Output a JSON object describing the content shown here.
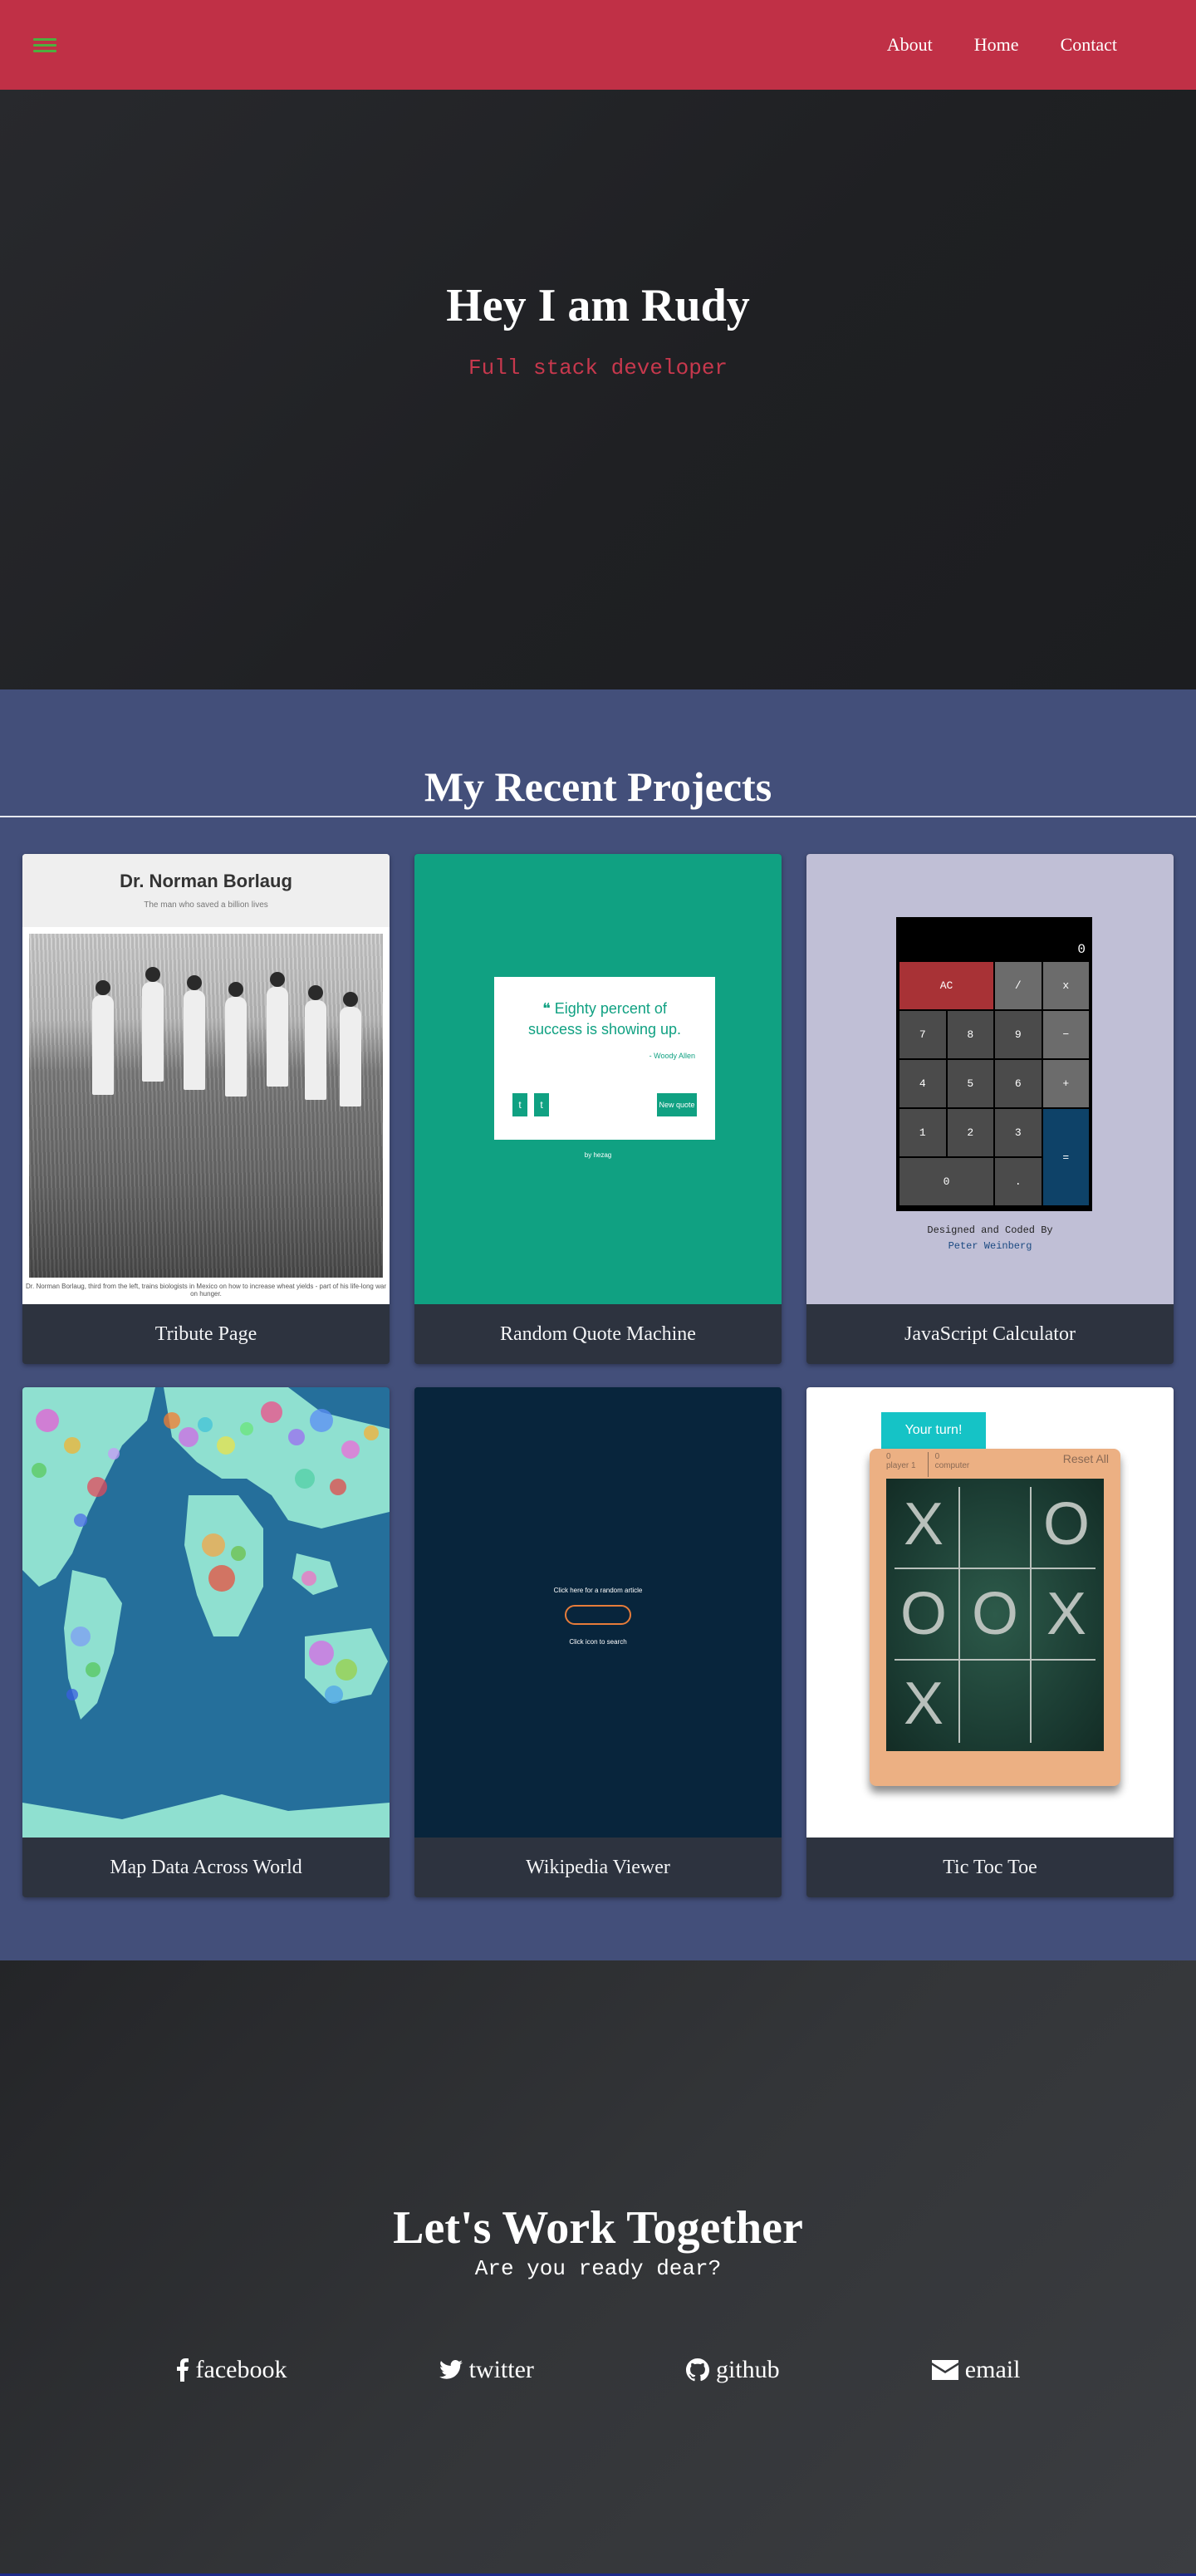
{
  "nav": {
    "links": [
      "About",
      "Home",
      "Contact"
    ],
    "colors": {
      "bar": "#c03046",
      "menu_icon": "#4fae3e"
    }
  },
  "hero": {
    "title": "Hey I am Rudy",
    "subtitle": "Full stack developer"
  },
  "projects": {
    "heading": "My Recent Projects",
    "items": [
      {
        "title": "Tribute Page",
        "thumb_icon": "tribute-screenshot"
      },
      {
        "title": "Random Quote Machine",
        "thumb_icon": "quote-screenshot"
      },
      {
        "title": "JavaScript Calculator",
        "thumb_icon": "calculator-screenshot"
      },
      {
        "title": "Map Data Across World",
        "thumb_icon": "map-screenshot"
      },
      {
        "title": "Wikipedia Viewer",
        "thumb_icon": "wiki-screenshot"
      },
      {
        "title": "Tic Toc Toe",
        "thumb_icon": "tictactoe-screenshot"
      }
    ],
    "thumbs": {
      "tribute": {
        "heading": "Dr. Norman Borlaug",
        "subheading": "The man who saved a billion lives",
        "caption": "Dr. Norman Borlaug, third from the left, trains biologists in Mexico on how to increase wheat yields - part of his life-long war on hunger."
      },
      "quote": {
        "text": "Eighty percent of success is showing up.",
        "author": "- Woody Allen",
        "tweet_label": "t",
        "tumblr_label": "t",
        "new_quote_label": "New quote",
        "by_label": "by hezag"
      },
      "calc": {
        "display": "0",
        "keys": [
          "AC",
          "/",
          "x",
          "7",
          "8",
          "9",
          "−",
          "4",
          "5",
          "6",
          "+",
          "1",
          "2",
          "3",
          "=",
          "0",
          "."
        ],
        "credit_line": "Designed and Coded By",
        "credit_name": "Peter Weinberg"
      },
      "wiki": {
        "top_text": "Click here for a random article",
        "bottom_text": "Click icon to search"
      },
      "ttt": {
        "turn_label": "Your turn!",
        "player_label": "player 1",
        "player_score": "0",
        "computer_label": "computer",
        "computer_score": "0",
        "reset_label": "Reset All",
        "cells": [
          "X",
          "",
          "O",
          "O",
          "O",
          "X",
          "X",
          "",
          ""
        ]
      }
    }
  },
  "contact": {
    "heading": "Let's Work Together",
    "subheading": "Are you ready dear?",
    "socials": [
      {
        "label": "facebook",
        "icon": "facebook-icon"
      },
      {
        "label": "twitter",
        "icon": "twitter-icon"
      },
      {
        "label": "github",
        "icon": "github-icon"
      },
      {
        "label": "email",
        "icon": "envelope-icon"
      }
    ]
  }
}
